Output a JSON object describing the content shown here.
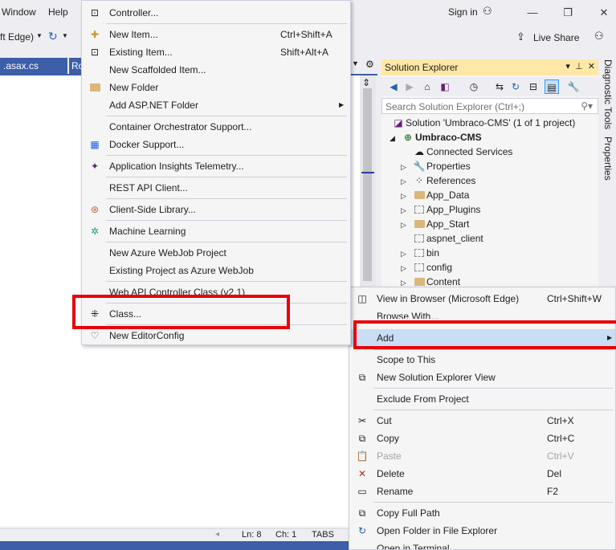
{
  "menubar": {
    "window": "Window",
    "help": "Help",
    "sign_in": "Sign in"
  },
  "toolbar": {
    "browser_label": "ft Edge)",
    "live_share": "Live Share"
  },
  "editor": {
    "tab1": ".asax.cs",
    "tab2": "Ro"
  },
  "status": {
    "ln": "Ln: 8",
    "ch": "Ch: 1",
    "tabs": "TABS"
  },
  "solution_explorer": {
    "title": "Solution Explorer",
    "search_placeholder": "Search Solution Explorer (Ctrl+;)",
    "solution": "Solution 'Umbraco-CMS' (1 of 1 project)",
    "project": "Umbraco-CMS",
    "items": [
      "Connected Services",
      "Properties",
      "References",
      "App_Data",
      "App_Plugins",
      "App_Start",
      "aspnet_client",
      "bin",
      "config",
      "Content"
    ]
  },
  "side_tabs": {
    "diagnostic": "Diagnostic Tools",
    "properties": "Properties"
  },
  "add_submenu": {
    "items": [
      {
        "label": "Controller...",
        "shortcut": "",
        "icon": "controller-icon"
      },
      {
        "label": "New Item...",
        "shortcut": "Ctrl+Shift+A",
        "icon": "new-item-icon"
      },
      {
        "label": "Existing Item...",
        "shortcut": "Shift+Alt+A",
        "icon": "existing-item-icon"
      },
      {
        "label": "New Scaffolded Item...",
        "shortcut": "",
        "icon": ""
      },
      {
        "label": "New Folder",
        "shortcut": "",
        "icon": "new-folder-icon"
      },
      {
        "label": "Add ASP.NET Folder",
        "shortcut": "",
        "icon": ""
      },
      {
        "label": "Container Orchestrator Support...",
        "shortcut": "",
        "icon": ""
      },
      {
        "label": "Docker Support...",
        "shortcut": "",
        "icon": "docker-icon"
      },
      {
        "label": "Application Insights Telemetry...",
        "shortcut": "",
        "icon": "app-insights-icon"
      },
      {
        "label": "REST API Client...",
        "shortcut": "",
        "icon": ""
      },
      {
        "label": "Client-Side Library...",
        "shortcut": "",
        "icon": "library-icon"
      },
      {
        "label": "Machine Learning",
        "shortcut": "",
        "icon": "ml-icon"
      },
      {
        "label": "New Azure WebJob Project",
        "shortcut": "",
        "icon": ""
      },
      {
        "label": "Existing Project as Azure WebJob",
        "shortcut": "",
        "icon": ""
      },
      {
        "label": "Web API Controller Class (v2.1)",
        "shortcut": "",
        "icon": ""
      },
      {
        "label": "Class...",
        "shortcut": "",
        "icon": "class-icon"
      },
      {
        "label": "New EditorConfig",
        "shortcut": "",
        "icon": "editorconfig-icon"
      }
    ]
  },
  "context_menu": {
    "items": [
      {
        "label": "View in Browser (Microsoft Edge)",
        "shortcut": "Ctrl+Shift+W"
      },
      {
        "label": "Browse With...",
        "shortcut": ""
      },
      {
        "label": "Add",
        "shortcut": ""
      },
      {
        "label": "Scope to This",
        "shortcut": ""
      },
      {
        "label": "New Solution Explorer View",
        "shortcut": ""
      },
      {
        "label": "Exclude From Project",
        "shortcut": ""
      },
      {
        "label": "Cut",
        "shortcut": "Ctrl+X"
      },
      {
        "label": "Copy",
        "shortcut": "Ctrl+C"
      },
      {
        "label": "Paste",
        "shortcut": "Ctrl+V"
      },
      {
        "label": "Delete",
        "shortcut": "Del"
      },
      {
        "label": "Rename",
        "shortcut": "F2"
      },
      {
        "label": "Copy Full Path",
        "shortcut": ""
      },
      {
        "label": "Open Folder in File Explorer",
        "shortcut": ""
      },
      {
        "label": "Open in Terminal",
        "shortcut": ""
      }
    ]
  },
  "colors": {
    "highlight_box": "#e8000b",
    "accent": "#3d5ea8",
    "selected": "#c9def5"
  }
}
